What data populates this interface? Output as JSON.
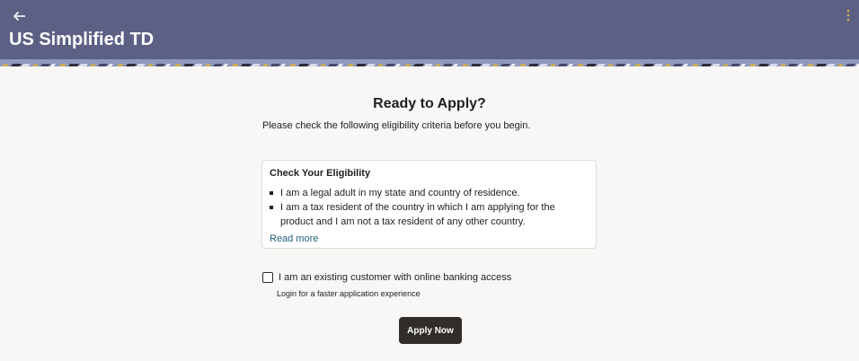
{
  "header": {
    "title": "US Simplified TD",
    "back_icon": "arrow-left-icon",
    "menu_icon": "kebab-menu-icon",
    "background_color": "#5b6084"
  },
  "main": {
    "heading": "Ready to Apply?",
    "subtitle": "Please check the following eligibility criteria before you begin.",
    "eligibility": {
      "title": "Check Your Eligibility",
      "criteria": [
        "I am a legal adult in my state and country of residence.",
        "I am a tax resident of the country in which I am applying for the product and I am not a tax resident of any other country."
      ],
      "read_more_label": "Read more"
    },
    "existing_customer": {
      "checked": false,
      "label": "I am an existing customer with online banking access",
      "hint": "Login for a faster application experience"
    },
    "apply_button_label": "Apply Now"
  },
  "colors": {
    "accent_link": "#23627d",
    "button_bg": "#312d2a",
    "page_bg": "#f8f7f5"
  }
}
